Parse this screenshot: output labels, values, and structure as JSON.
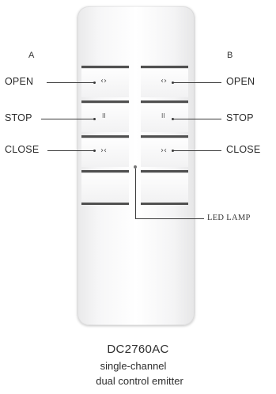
{
  "remote": {
    "model": "DC2760AC",
    "description_line1": "single-channel",
    "description_line2": "dual control emitter",
    "glyphs": {
      "open_left": "‹›",
      "open_right": "‹›",
      "stop": "II",
      "close": "›‹"
    }
  },
  "labels": {
    "channel_a": "A",
    "channel_b": "B",
    "open_left": "OPEN",
    "stop_left": "STOP",
    "close_left": "CLOSE",
    "open_right": "OPEN",
    "stop_right": "STOP",
    "close_right": "CLOSE",
    "led": "LED LAMP"
  }
}
